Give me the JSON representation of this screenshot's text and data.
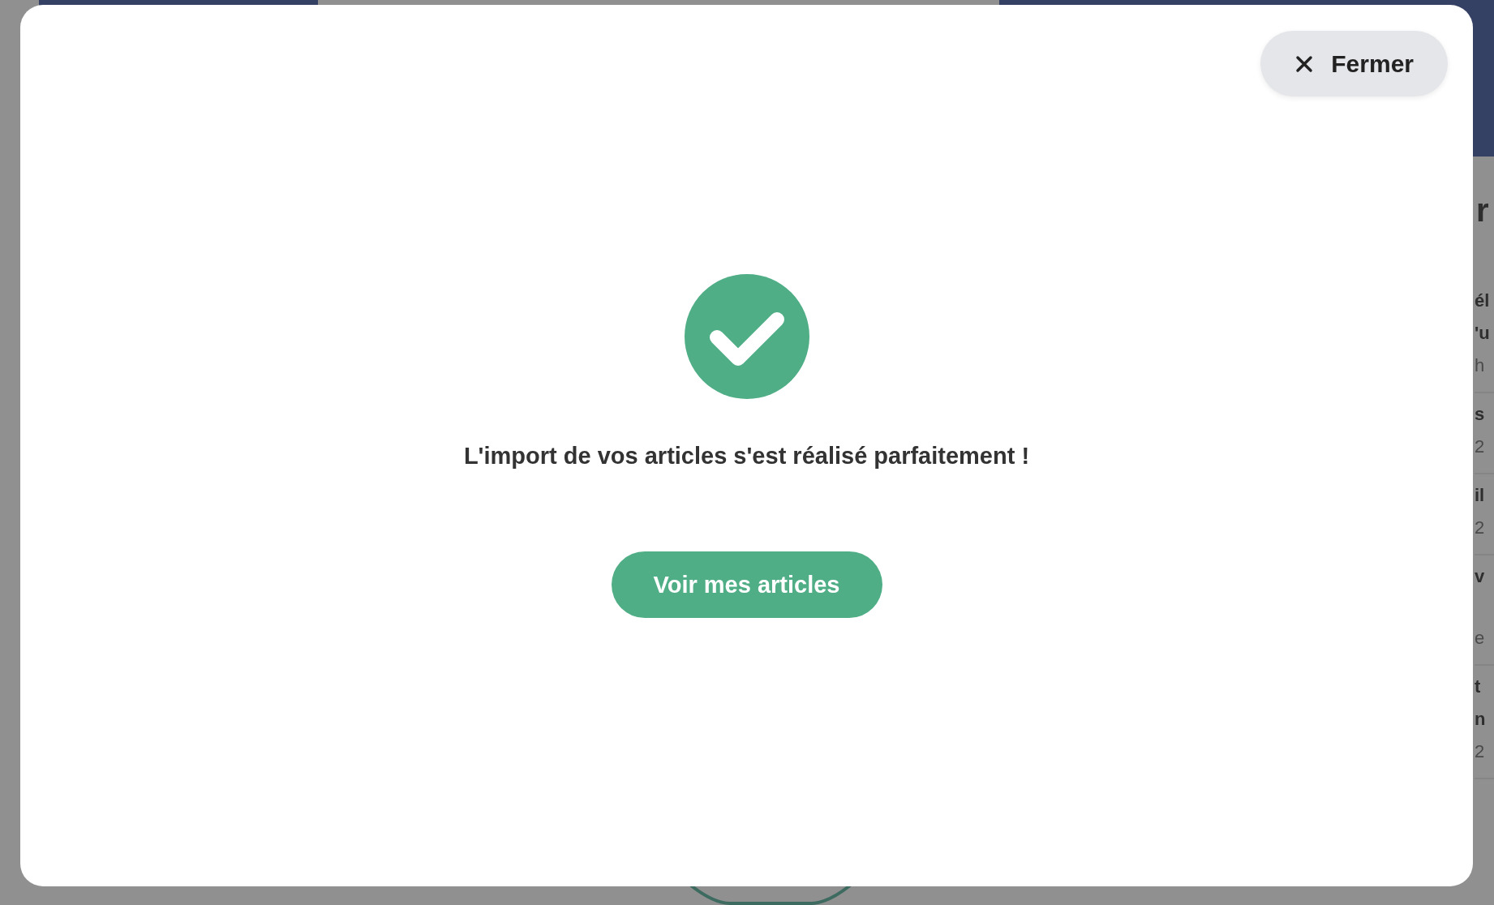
{
  "background": {
    "heading": "r",
    "items": [
      {
        "title_lines": [
          "él",
          "'u"
        ],
        "meta": "h"
      },
      {
        "title_lines": [
          "s"
        ],
        "meta": "2"
      },
      {
        "title_lines": [
          "il"
        ],
        "meta": "2"
      },
      {
        "title_lines": [
          "v"
        ],
        "meta": "e"
      },
      {
        "title_lines": [
          "t",
          "n"
        ],
        "meta": "2"
      }
    ]
  },
  "modal": {
    "close_button": "Fermer",
    "message": "L'import de vos articles s'est réalisé parfaitement !",
    "action_button": "Voir mes articles"
  }
}
